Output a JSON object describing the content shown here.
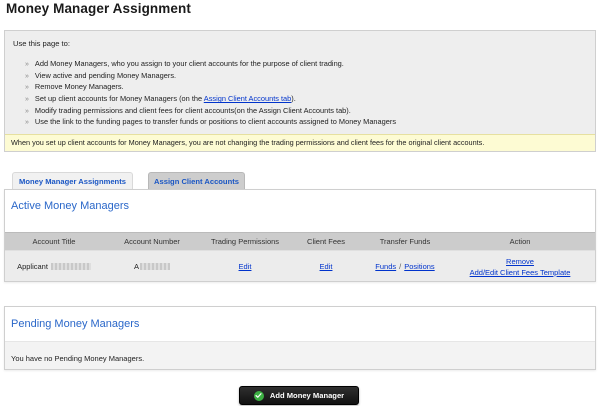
{
  "page": {
    "title": "Money Manager Assignment"
  },
  "info": {
    "intro": "Use this page to:",
    "items": [
      {
        "text": "Add Money Managers, who you assign to your client accounts for the purpose of client trading."
      },
      {
        "text": "View active and pending Money Managers."
      },
      {
        "text": "Remove Money Managers."
      },
      {
        "text_before": "Set up client accounts for Money Managers (on the ",
        "link": "Assign Client Accounts tab",
        "text_after": ")."
      },
      {
        "text": "Modify trading permissions and client fees for client accounts(on the Assign Client Accounts tab)."
      },
      {
        "text": "Use the link to the funding pages to transfer funds or positions to client accounts assigned to Money Managers"
      }
    ],
    "note": "When you set up client accounts for Money Managers, you are not changing the trading permissions and client fees for the original client accounts."
  },
  "tabs": [
    {
      "label": "Money Manager Assignments"
    },
    {
      "label": "Assign Client Accounts"
    }
  ],
  "active": {
    "title": "Active Money Managers",
    "columns": [
      "Account Title",
      "Account Number",
      "Trading Permissions",
      "Client Fees",
      "Transfer Funds",
      "Action"
    ],
    "rows": [
      {
        "account_title": "Applicant",
        "account_number": "A",
        "trading_permissions": "Edit",
        "client_fees": "Edit",
        "transfer_funds": "Funds",
        "transfer_positions": "Positions",
        "transfer_sep": "/",
        "action_remove": "Remove",
        "action_template": "Add/Edit Client Fees Template"
      }
    ]
  },
  "pending": {
    "title": "Pending Money Managers",
    "empty_message": "You have no Pending Money Managers."
  },
  "buttons": {
    "add_money_manager": "Add Money Manager"
  },
  "colors": {
    "link": "#0033cc",
    "heading_blue": "#2a67c9",
    "note_bg": "#fdfbd3",
    "button_bg": "#1a1a1a",
    "check_green": "#3cb043"
  },
  "icons": {
    "add_button_icon": "check-icon",
    "bullet": "chevron-right-icon"
  }
}
